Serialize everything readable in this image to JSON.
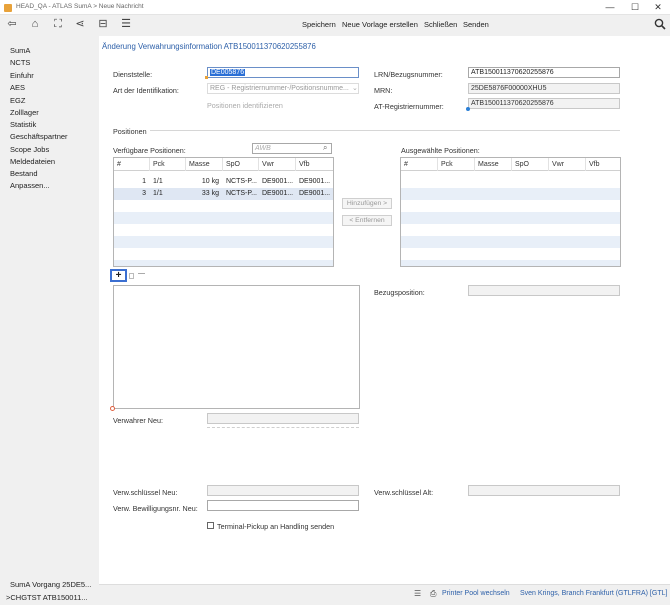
{
  "window": {
    "title": "HEAD_QA - ATLAS SumA > Neue Nachricht",
    "minimize": "—",
    "maximize": "☐",
    "close": "✕"
  },
  "toolbar": {
    "save": "Speichern",
    "new_template": "Neue Vorlage erstellen",
    "close": "Schließen",
    "send": "Senden"
  },
  "sidebar": {
    "items": [
      "SumA",
      "NCTS",
      "Einfuhr",
      "AES",
      "EGZ",
      "Zolllager",
      "Statistik",
      "Geschäftspartner",
      "Scope Jobs",
      "Meldedateien",
      "Bestand",
      "Anpassen..."
    ],
    "bottom": [
      "SumA Vorgang 25DE5...",
      ">CHGTST ATB150011..."
    ]
  },
  "page": {
    "title": "Änderung Verwahrungsinformation  ATB150011370620255876"
  },
  "form": {
    "dienststelle_label": "Dienststelle:",
    "dienststelle_value": "DE005876",
    "art_label": "Art der Identifikation:",
    "art_value": "REG - Registriernummer-/Positionsnumme...",
    "identify_positions": "Positionen identifizieren",
    "lrn_label": "LRN/Bezugsnummer:",
    "lrn_value": "ATB150011370620255876",
    "mrn_label": "MRN:",
    "mrn_value": "25DE5876F00000XHU5",
    "at_label": "AT-Registriernummer:",
    "at_value": "ATB150011370620255876"
  },
  "positions": {
    "section_title": "Positionen",
    "available_label": "Verfügbare Positionen:",
    "awb_placeholder": "AWB",
    "selected_label": "Ausgewählte Positionen:",
    "columns_available": [
      "#",
      "Pck",
      "Masse",
      "SpO",
      "Vwr",
      "Vfb"
    ],
    "columns_selected": [
      "#",
      "Pck",
      "Masse",
      "SpO",
      "Vwr",
      "Vfb"
    ],
    "rows": [
      [
        "1",
        "1/1",
        "10 kg",
        "NCTS-P...",
        "DE9001...",
        "DE9001..."
      ],
      [
        "3",
        "1/1",
        "33 kg",
        "NCTS-P...",
        "DE9001...",
        "DE9001..."
      ]
    ],
    "add_button": "Hinzufügen >",
    "remove_button": "< Entfernen"
  },
  "detail": {
    "plus": "+",
    "minus": "—",
    "bezugsposition_label": "Bezugsposition:",
    "verwahrer_label": "Verwahrer Neu:",
    "verwschluessel_neu_label": "Verw.schlüssel Neu:",
    "verwschluessel_alt_label": "Verw.schlüssel Alt:",
    "bewilligung_label": "Verw. Bewilligungsnr. Neu:",
    "terminal_pickup_label": "Terminal-Pickup an Handling senden"
  },
  "status": {
    "printer": "Printer Pool wechseln",
    "user": "Sven Krings, Branch Frankfurt (GTLFRA) [GTL]"
  }
}
